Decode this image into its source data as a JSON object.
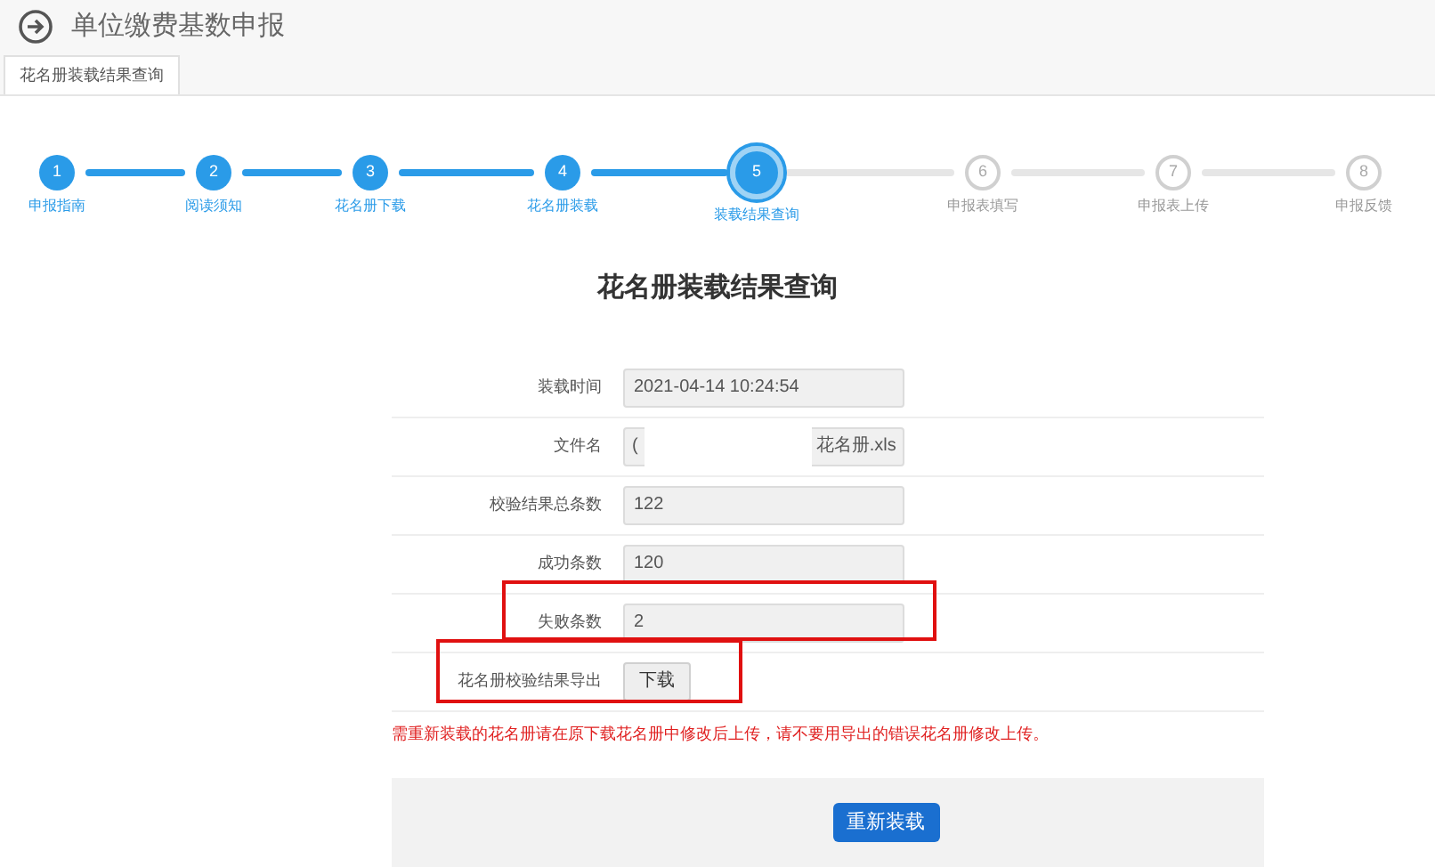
{
  "header": {
    "title": "单位缴费基数申报"
  },
  "tabs": [
    {
      "label": "花名册装载结果查询",
      "selected": true
    }
  ],
  "steps": [
    {
      "number": "1",
      "label": "申报指南",
      "completed": true,
      "selected": false
    },
    {
      "number": "2",
      "label": "阅读须知",
      "completed": true,
      "selected": false
    },
    {
      "number": "3",
      "label": "花名册下载",
      "completed": true,
      "selected": false
    },
    {
      "number": "4",
      "label": "花名册装载",
      "completed": true,
      "selected": false
    },
    {
      "number": "5",
      "label": "装载结果查询",
      "completed": true,
      "selected": true
    },
    {
      "number": "6",
      "label": "申报表填写",
      "completed": false,
      "selected": false
    },
    {
      "number": "7",
      "label": "申报表上传",
      "completed": false,
      "selected": false
    },
    {
      "number": "8",
      "label": "申报反馈",
      "completed": false,
      "selected": false
    }
  ],
  "form": {
    "title": "花名册装载结果查询",
    "rows": [
      {
        "kind": "field",
        "label": "装载时间",
        "value": "2021-04-14 10:24:54",
        "highlighted": false
      },
      {
        "kind": "redacted",
        "label": "文件名",
        "value": "(",
        "value_end": "花名册.xls",
        "highlighted": false
      },
      {
        "kind": "field",
        "label": "校验结果总条数",
        "value": "122",
        "highlighted": false
      },
      {
        "kind": "field",
        "label": "成功条数",
        "value": "120",
        "highlighted": false
      },
      {
        "kind": "field",
        "label": "失败条数",
        "value": "2",
        "highlighted": true
      },
      {
        "kind": "button",
        "label": "花名册校验结果导出",
        "button": "下载",
        "highlighted": true
      }
    ],
    "notice": "需重新装载的花名册请在原下载花名册中修改后上传，请不要用导出的错误花名册修改上传。",
    "submit": "重新装载"
  }
}
